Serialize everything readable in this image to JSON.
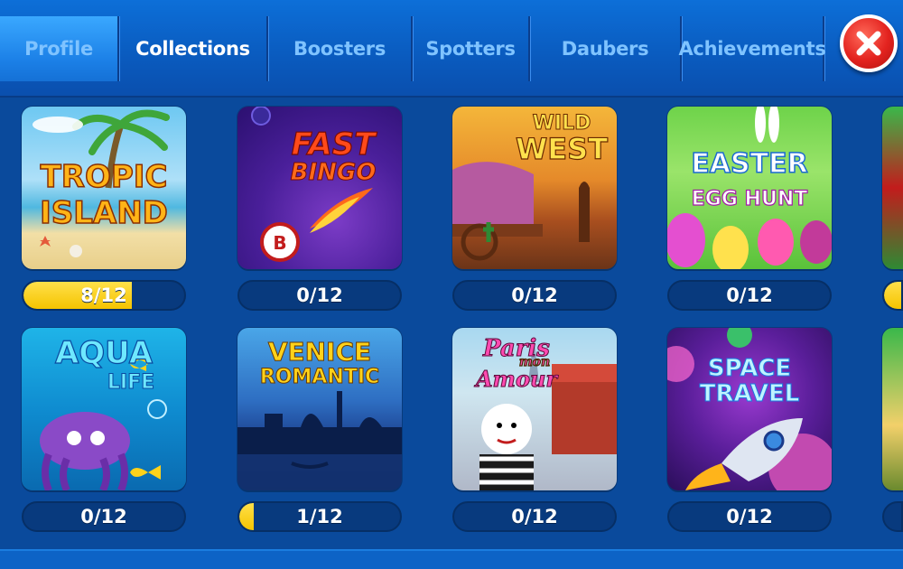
{
  "tabs": [
    {
      "label": "Profile",
      "active": false
    },
    {
      "label": "Collections",
      "active": true
    },
    {
      "label": "Boosters",
      "active": false
    },
    {
      "label": "Spotters",
      "active": false
    },
    {
      "label": "Daubers",
      "active": false
    },
    {
      "label": "Achievements",
      "active": false
    }
  ],
  "close_icon": "close-x-icon",
  "collections": [
    {
      "name_line1": "TROPIC",
      "name_line2": "ISLAND",
      "progress": "8/12",
      "progress_fraction": 0.6667
    },
    {
      "name_line1": "FAST",
      "name_line2": "BINGO",
      "progress": "0/12",
      "progress_fraction": 0
    },
    {
      "name_line1": "WILD",
      "name_line2": "WEST",
      "progress": "0/12",
      "progress_fraction": 0
    },
    {
      "name_line1": "EASTER",
      "name_line2": "EGG HUNT",
      "progress": "0/12",
      "progress_fraction": 0
    },
    {
      "name_line1": "AQUA",
      "name_line2": "LIFE",
      "progress": "0/12",
      "progress_fraction": 0
    },
    {
      "name_line1": "VENICE",
      "name_line2": "ROMANTIC",
      "progress": "1/12",
      "progress_fraction": 0.0833
    },
    {
      "name_line1": "Paris",
      "name_line2": "mon",
      "name_line3": "Amour",
      "progress": "0/12",
      "progress_fraction": 0
    },
    {
      "name_line1": "SPACE",
      "name_line2": "TRAVEL",
      "progress": "0/12",
      "progress_fraction": 0
    }
  ],
  "colors": {
    "background": "#0a4a9c",
    "tab_inactive": "#7fc3ff",
    "tab_active": "#ffffff",
    "progress_fill": "#f5c400",
    "close_button": "#e3231f"
  }
}
